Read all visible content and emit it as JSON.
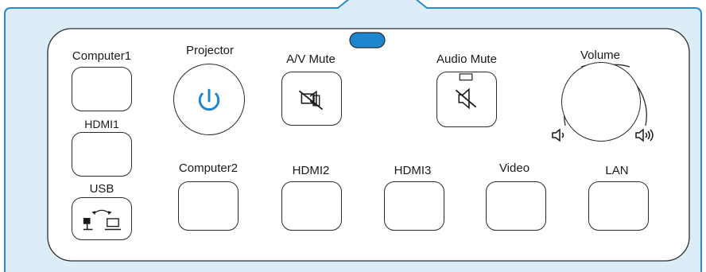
{
  "colors": {
    "background": "#ffffff",
    "panel_fill": "#dcedf8",
    "panel_border": "#2a8cc8",
    "button_border": "#2b2b2b",
    "indicator": "#1d86cf",
    "power_icon": "#1d86cf"
  },
  "labels": {
    "computer1": "Computer1",
    "projector": "Projector",
    "av_mute": "A/V Mute",
    "audio_mute": "Audio Mute",
    "volume": "Volume",
    "hdmi1": "HDMI1",
    "usb": "USB",
    "computer2": "Computer2",
    "hdmi2": "HDMI2",
    "hdmi3": "HDMI3",
    "video": "Video",
    "lan": "LAN"
  },
  "icons": {
    "power": "power-icon",
    "av_mute": "crossed-camera-speaker-icon",
    "audio_mute": "crossed-speaker-icon",
    "volume_down": "speaker-low-icon",
    "volume_up": "speaker-high-icon",
    "usb": "usb-camera-to-computer-icon",
    "indicator": "status-indicator-light"
  }
}
